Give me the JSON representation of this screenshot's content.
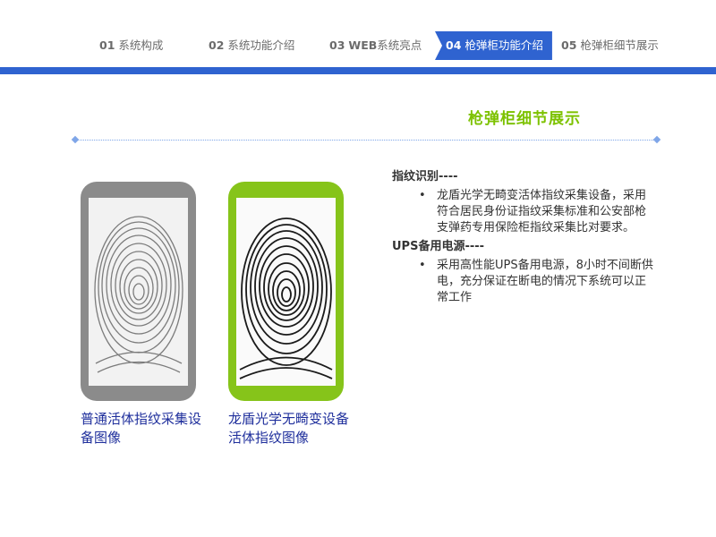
{
  "nav": {
    "items": [
      {
        "num": "01",
        "label": "系统构成"
      },
      {
        "num": "02",
        "label": "系统功能介绍"
      },
      {
        "num": "03",
        "label_web": "WEB",
        "label": "系统亮点"
      },
      {
        "num": "04",
        "label": "枪弹柜功能介绍"
      },
      {
        "num": "05",
        "label": "枪弹柜细节展示"
      }
    ],
    "active_index": 3,
    "accent_color": "#2f63d0"
  },
  "section": {
    "title": "枪弹柜细节展示",
    "title_color": "#7dc200"
  },
  "phones": [
    {
      "frame_color": "#8b8b8b",
      "image": "fingerprint-icon",
      "caption": "普通活体指纹采集设备图像"
    },
    {
      "frame_color": "#86c41a",
      "image": "fingerprint-icon",
      "caption": "龙盾光学无畸变设备活体指纹图像"
    }
  ],
  "features": [
    {
      "heading": "指纹识别----",
      "bullets": [
        "龙盾光学无畸变活体指纹采集设备，采用符合居民身份证指纹采集标准和公安部枪支弹药专用保险柜指纹采集比对要求。"
      ]
    },
    {
      "heading": "UPS备用电源----",
      "bullets": [
        "采用高性能UPS备用电源，8小时不间断供电，充分保证在断电的情况下系统可以正常工作"
      ]
    }
  ],
  "bullet_char": "•"
}
